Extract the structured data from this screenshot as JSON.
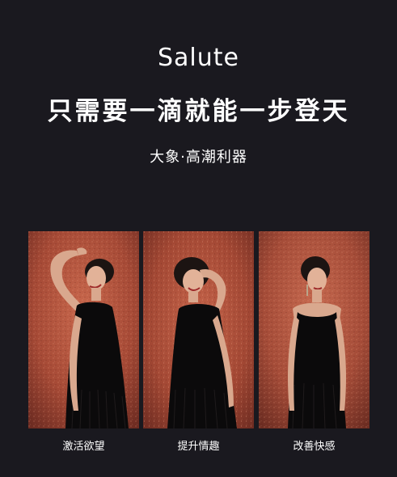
{
  "brand": "Salute",
  "headline": "只需要一滴就能一步登天",
  "subline": "大象·高潮利器",
  "panels": [
    {
      "caption": "激活欲望",
      "photo": "woman-arm-raised-photo"
    },
    {
      "caption": "提升情趣",
      "photo": "woman-hand-on-head-photo"
    },
    {
      "caption": "改善快感",
      "photo": "woman-standing-photo"
    }
  ],
  "colors": {
    "background": "#1a191f",
    "backdrop": "#b3543f",
    "text": "#ffffff"
  }
}
